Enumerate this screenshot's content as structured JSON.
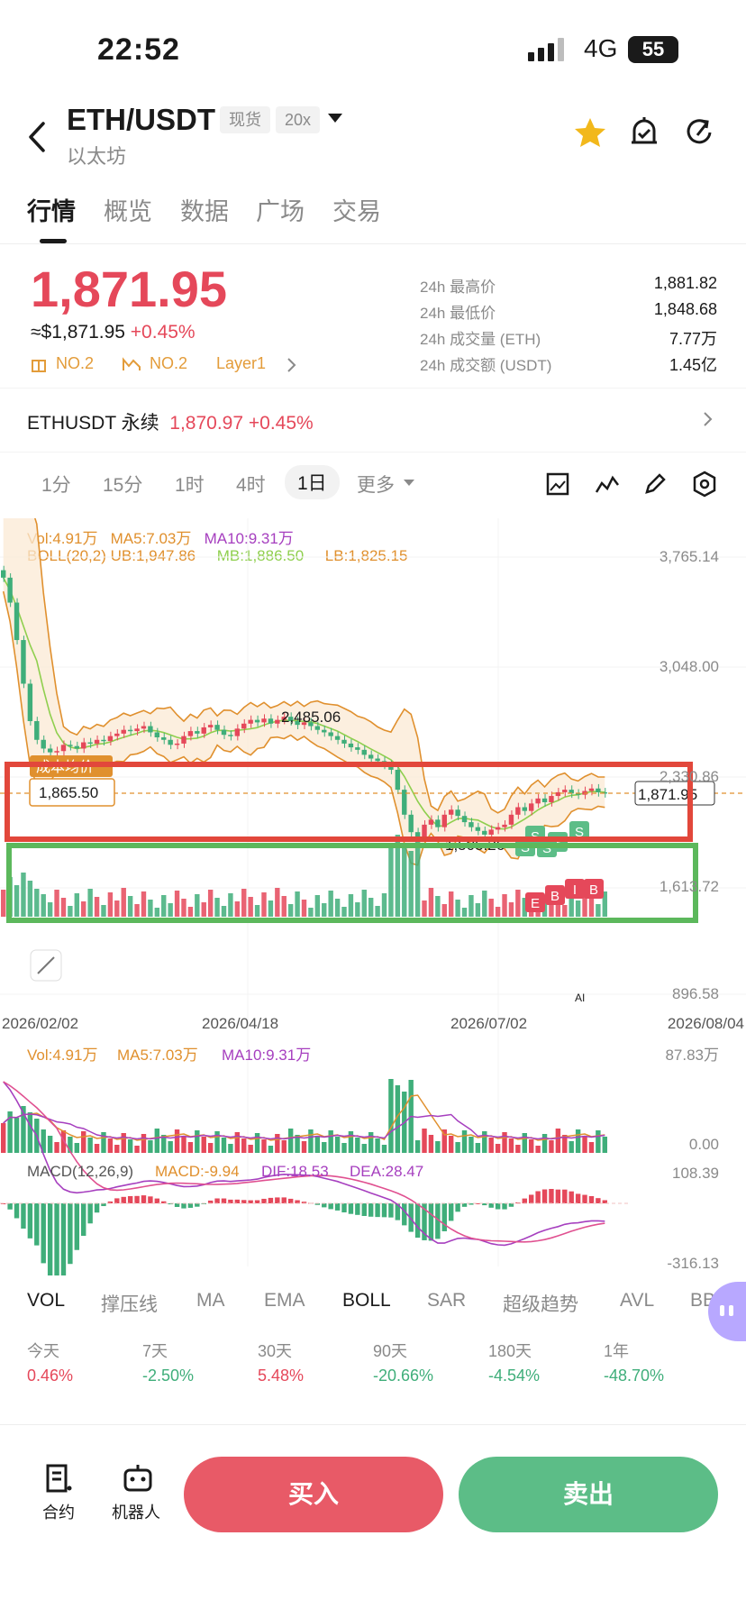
{
  "status_bar": {
    "time": "22:52",
    "network": "4G",
    "battery": "55"
  },
  "header": {
    "pair": "ETH/USDT",
    "subtitle": "以太坊",
    "tag_spot": "现货",
    "tag_leverage": "20x"
  },
  "tabs": [
    {
      "label": "行情"
    },
    {
      "label": "概览"
    },
    {
      "label": "数据"
    },
    {
      "label": "广场"
    },
    {
      "label": "交易"
    }
  ],
  "price": {
    "last": "1,871.95",
    "usd_prefix": "≈$1,871.95",
    "change": "+0.45%",
    "rank1": "NO.2",
    "rank2": "NO.2",
    "category": "Layer1"
  },
  "stats": [
    {
      "label": "24h 最高价",
      "value": "1,881.82"
    },
    {
      "label": "24h 最低价",
      "value": "1,848.68"
    },
    {
      "label": "24h 成交量 (ETH)",
      "value": "7.77万"
    },
    {
      "label": "24h 成交额 (USDT)",
      "value": "1.45亿"
    }
  ],
  "perp": {
    "name": "ETHUSDT 永续",
    "price": "1,870.97",
    "change": "+0.45%"
  },
  "intervals": [
    {
      "label": "1分"
    },
    {
      "label": "15分"
    },
    {
      "label": "1时"
    },
    {
      "label": "4时"
    },
    {
      "label": "1日"
    },
    {
      "label": "更多"
    }
  ],
  "indicators": {
    "vol": "Vol:4.91万",
    "ma5": "MA5:7.03万",
    "ma10": "MA10:9.31万",
    "boll": "BOLL(20,2)",
    "ub": "UB:1,947.86",
    "mb": "MB:1,886.50",
    "lb": "LB:1,825.15"
  },
  "chart_data": {
    "type": "candlestick",
    "price_axis": [
      "3,765.14",
      "3,048.00",
      "2,330.86",
      "1,613.72",
      "896.58"
    ],
    "date_axis": [
      "2026/02/02",
      "2026/04/18",
      "2026/07/02",
      "2026/08/04"
    ],
    "markers": {
      "high": "2,485.06",
      "low": "1,505.26",
      "current": "1,871.95",
      "cost_label": "成本均价",
      "cost": "1,865.50"
    },
    "volume": {
      "vol": "Vol:4.91万",
      "ma5": "MA5:7.03万",
      "ma10": "MA10:9.31万",
      "axis_max": "87.83万",
      "axis_min": "0.00"
    },
    "macd": {
      "label": "MACD(12,26,9)",
      "macd": "MACD:-9.94",
      "dif": "DIF:18.53",
      "dea": "DEA:28.47",
      "axis_max": "108.39",
      "axis_min": "-316.13"
    },
    "close": [
      3600,
      3400,
      3100,
      2750,
      2450,
      2300,
      2230,
      2200,
      2210,
      2260,
      2250,
      2230,
      2280,
      2270,
      2300,
      2290,
      2330,
      2350,
      2380,
      2370,
      2390,
      2410,
      2360,
      2320,
      2300,
      2260,
      2270,
      2330,
      2370,
      2350,
      2400,
      2420,
      2380,
      2340,
      2330,
      2390,
      2430,
      2460,
      2440,
      2470,
      2430,
      2460,
      2485,
      2450,
      2420,
      2440,
      2410,
      2380,
      2360,
      2330,
      2300,
      2270,
      2240,
      2220,
      2180,
      2150,
      2130,
      2100,
      2060,
      1900,
      1700,
      1560,
      1520,
      1620,
      1660,
      1600,
      1700,
      1740,
      1690,
      1640,
      1600,
      1570,
      1540,
      1580,
      1600,
      1620,
      1700,
      1760,
      1730,
      1790,
      1830,
      1800,
      1850,
      1880,
      1900,
      1870,
      1860,
      1890,
      1910,
      1880,
      1872
    ],
    "badges": [
      "S",
      "S",
      "S",
      "S",
      "S",
      "E",
      "B",
      "I",
      "B"
    ],
    "colors": {
      "up": "#e5485a",
      "down": "#3fae7a",
      "boll_ub": "#e0902e",
      "boll_mb": "#8fcf4e",
      "ma10": "#a63fbf",
      "annot_red": "#e2473b",
      "annot_green": "#5cb85c"
    }
  },
  "bottom_tabs": [
    {
      "label": "VOL"
    },
    {
      "label": "撑压线"
    },
    {
      "label": "MA"
    },
    {
      "label": "EMA"
    },
    {
      "label": "BOLL"
    },
    {
      "label": "SAR"
    },
    {
      "label": "超级趋势"
    },
    {
      "label": "AVL"
    },
    {
      "label": "BBI"
    }
  ],
  "performance": [
    {
      "label": "今天",
      "value": "0.46%",
      "dir": "up"
    },
    {
      "label": "7天",
      "value": "-2.50%",
      "dir": "down"
    },
    {
      "label": "30天",
      "value": "5.48%",
      "dir": "up"
    },
    {
      "label": "90天",
      "value": "-20.66%",
      "dir": "down"
    },
    {
      "label": "180天",
      "value": "-4.54%",
      "dir": "down"
    },
    {
      "label": "1年",
      "value": "-48.70%",
      "dir": "down"
    }
  ],
  "footer": {
    "contract": "合约",
    "bot": "机器人",
    "buy": "买入",
    "sell": "卖出"
  }
}
